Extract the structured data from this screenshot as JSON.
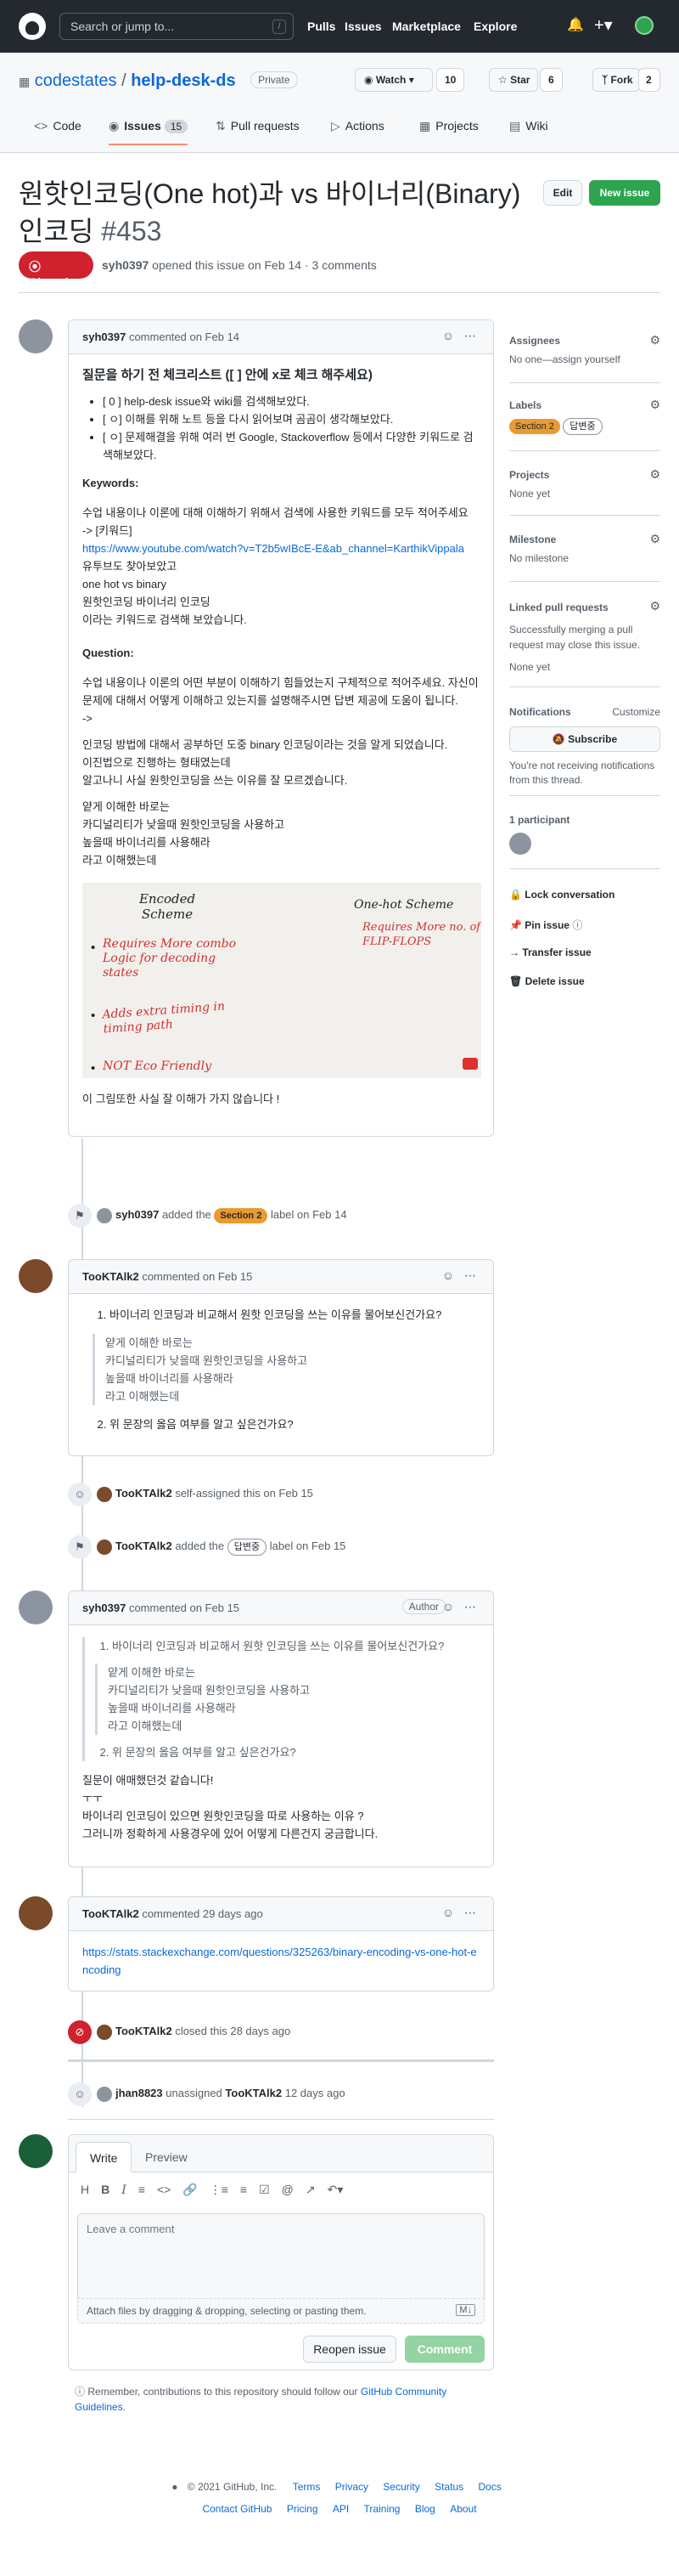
{
  "header": {
    "search_placeholder": "Search or jump to...",
    "slash_key": "/",
    "nav": [
      "Pulls",
      "Issues",
      "Marketplace",
      "Explore"
    ]
  },
  "repo": {
    "owner": "codestates",
    "separator": "/",
    "name": "help-desk-ds",
    "visibility": "Private",
    "watch_label": "Watch",
    "watch_count": "10",
    "star_label": "Star",
    "star_count": "6",
    "fork_label": "Fork",
    "fork_count": "2",
    "tabs": [
      {
        "label": "Code",
        "icon": "code-icon"
      },
      {
        "label": "Issues",
        "icon": "issue-icon",
        "count": "15"
      },
      {
        "label": "Pull requests",
        "icon": "pull-request-icon"
      },
      {
        "label": "Actions",
        "icon": "play-icon"
      },
      {
        "label": "Projects",
        "icon": "project-icon"
      },
      {
        "label": "Wiki",
        "icon": "book-icon"
      }
    ]
  },
  "issue": {
    "title": "원핫인코딩(One hot)과 vs 바이너리(Binary) 인코딩",
    "number": "#453",
    "edit_label": "Edit",
    "new_issue_label": "New issue",
    "state": "Closed",
    "author": "syh0397",
    "meta_text": "opened this issue on Feb 14 · 3 comments"
  },
  "comment1": {
    "author": "syh0397",
    "date": "commented on Feb 14",
    "heading": "질문을 하기 전 체크리스트 ([ ] 안에 x로 체크 해주세요)",
    "checklist": [
      "[ 0 ] help-desk issue와 wiki를 검색해보았다.",
      "[ ㅇ] 이해를 위해 노트 등을 다시 읽어보며 곰곰이 생각해보았다.",
      "[ ㅇ] 문제해결을 위해 여러 번 Google, Stackoverflow 등에서 다양한 키워드로 검색해보았다."
    ],
    "keywords_label": "Keywords:",
    "keywords_desc": "수업 내용이나 이론에 대해 이해하기 위해서 검색에 사용한 키워드를 모두 적어주세요",
    "keywords_arrow": "-> [키워드]",
    "link": "https://www.youtube.com/watch?v=T2b5wIBcE-E&ab_channel=KarthikVippala",
    "kw_lines": [
      "유투브도 찾아보았고",
      "one hot vs binary",
      "원핫인코딩 바이너리 인코딩",
      "이라는 키워드로 검색해 보았습니다."
    ],
    "question_label": "Question:",
    "question_desc": "수업 내용이나 이론의 어떤 부분이 이해하기 힘들었는지 구체적으로 적어주세요. 자신이 문제에 대해서 어떻게 이해하고 있는지를 설명해주시면 답변 제공에 도움이 됩니다.",
    "question_arrow": "->",
    "q_lines_a": [
      "인코딩 방법에 대해서 공부하던 도중 binary 인코딩이라는 것을 알게 되었습니다.",
      "이진법으로 진행하는 형태였는데",
      "알고나니 사실 원핫인코딩을 쓰는 이유를 잘 모르겠습니다."
    ],
    "q_lines_b": [
      "얕게 이해한 바로는",
      "카디널리티가 낮을때 원핫인코딩을 사용하고",
      "높을때 바이너리를 사용해라",
      "라고 이해했는데"
    ],
    "whiteboard": {
      "left_title": "Encoded Scheme",
      "right_title": "One-hot Scheme",
      "left_items": [
        "Requires More combo Logic for decoding states",
        "Adds extra timing in timing path",
        "NOT Eco Friendly"
      ],
      "right_items": [
        "Requires More no. of FLIP-FLOPS"
      ]
    },
    "closing": "이 그림또한 사실 잘 이해가 가지 않습니다 !"
  },
  "event_label1": {
    "actor": "syh0397",
    "verb": "added the",
    "label": "Section 2",
    "suffix": "label on Feb 14"
  },
  "comment2": {
    "author": "TooKTAlk2",
    "date": "commented on Feb 15",
    "q1": "바이너리 인코딩과 비교해서 원핫 인코딩을 쓰는 이유를 물어보신건가요?",
    "quote": [
      "얕게 이해한 바로는",
      "카디널리티가 낮을때 원핫인코딩을 사용하고",
      "높을때 바이너리를 사용해라",
      "라고 이해했는데"
    ],
    "q2": "위 문장의 옳음 여부를 알고 싶은건가요?"
  },
  "event_assign": {
    "actor": "TooKTAlk2",
    "text": "self-assigned this on Feb 15"
  },
  "event_label2": {
    "actor": "TooKTAlk2",
    "verb": "added the",
    "label": "답변중",
    "suffix": "label on Feb 15"
  },
  "comment3": {
    "author": "syh0397",
    "date": "commented on Feb 15",
    "badge": "Author",
    "q1": "바이너리 인코딩과 비교해서 원핫 인코딩을 쓰는 이유를 물어보신건가요?",
    "inner_quote": [
      "얕게 이해한 바로는",
      "카디널리티가 낮을때 원핫인코딩을 사용하고",
      "높을때 바이너리를 사용해라",
      "라고 이해했는데"
    ],
    "q2": "위 문장의 옳음 여부를 알고 싶은건가요?",
    "body": [
      "질문이 애매했던것 같습니다!",
      "ㅜㅜ",
      "바이너리 인코딩이 있으면 원핫인코딩을 따로 사용하는 이유 ?",
      "그러니까 정확하게 사용경우에 있어 어떻게 다른건지 궁금합니다."
    ]
  },
  "comment4": {
    "author": "TooKTAlk2",
    "date": "commented 29 days ago",
    "link": "https://stats.stackexchange.com/questions/325263/binary-encoding-vs-one-hot-encoding"
  },
  "event_closed": {
    "actor": "TooKTAlk2",
    "text": "closed this 28 days ago"
  },
  "event_unassign": {
    "actor": "jhan8823",
    "verb": "unassigned",
    "target": "TooKTAlk2",
    "suffix": "12 days ago"
  },
  "form": {
    "write_tab": "Write",
    "preview_tab": "Preview",
    "placeholder": "Leave a comment",
    "attach_text": "Attach files by dragging & dropping, selecting or pasting them.",
    "reopen_label": "Reopen issue",
    "comment_label": "Comment",
    "toolbar": [
      "H",
      "B",
      "I",
      "quote",
      "code",
      "link",
      "ul",
      "ol",
      "task",
      "@",
      "ref",
      "reply"
    ]
  },
  "remember_text": "Remember, contributions to this repository should follow our",
  "remember_link": "GitHub Community Guidelines",
  "sidebar": {
    "assignees_title": "Assignees",
    "assignees_value": "No one—assign yourself",
    "labels_title": "Labels",
    "labels": [
      {
        "name": "Section 2",
        "color": "#e99a30"
      },
      {
        "name": "답변중",
        "color": "#ffffff"
      }
    ],
    "projects_title": "Projects",
    "projects_value": "None yet",
    "milestone_title": "Milestone",
    "milestone_value": "No milestone",
    "linked_title": "Linked pull requests",
    "linked_desc": "Successfully merging a pull request may close this issue.",
    "linked_value": "None yet",
    "notifications_title": "Notifications",
    "customize": "Customize",
    "subscribe": "Subscribe",
    "notif_desc": "You're not receiving notifications from this thread.",
    "participants": "1 participant",
    "actions": [
      "Lock conversation",
      "Pin issue",
      "Transfer issue",
      "Delete issue"
    ]
  },
  "footer": {
    "copyright": "© 2021 GitHub, Inc.",
    "row1": [
      "Terms",
      "Privacy",
      "Security",
      "Status",
      "Docs"
    ],
    "row2": [
      "Contact GitHub",
      "Pricing",
      "API",
      "Training",
      "Blog",
      "About"
    ]
  },
  "colors": {
    "accent": "#0969da",
    "closed": "#cf222e",
    "success": "#2da44e",
    "section_label": "#e99a30"
  }
}
